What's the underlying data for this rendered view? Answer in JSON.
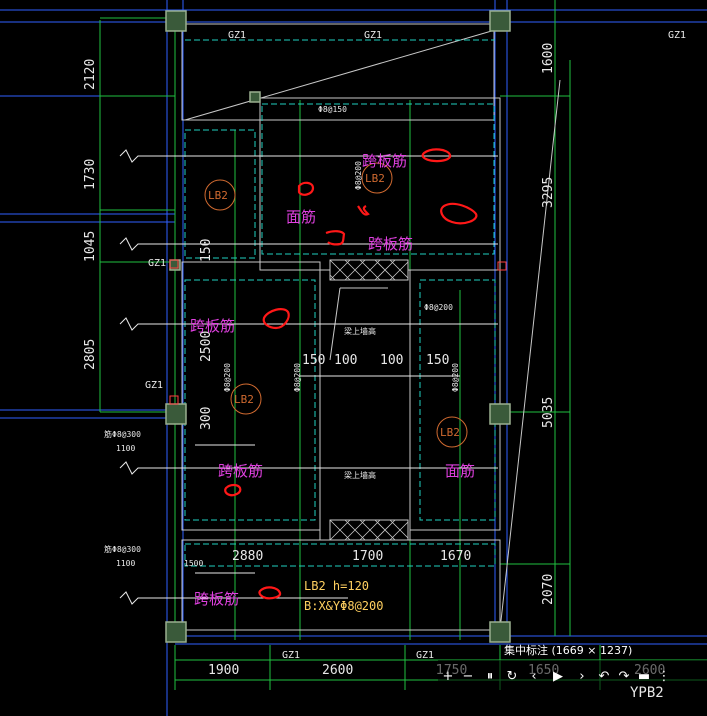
{
  "drawing": {
    "dims_left": [
      "2120",
      "1730",
      "1045",
      "2805"
    ],
    "dims_right": [
      "1600",
      "3295",
      "5035",
      "2070"
    ],
    "dims_middle": [
      "150",
      "100",
      "100",
      "150"
    ],
    "dims_middle_row": [
      "2880",
      "1700",
      "1670"
    ],
    "dims_bottom": [
      "1900",
      "2600",
      "1750",
      "1650",
      "2600"
    ],
    "dim_150": "150",
    "dim_2500": "2500",
    "dim_300": "300",
    "gz_tags": [
      "GZ1",
      "GZ1",
      "GZ1",
      "GZ1",
      "GZ1",
      "GZ1",
      "GZ1"
    ],
    "slab_tags": [
      "LB2",
      "LB2",
      "LB2",
      "LB2"
    ],
    "ypb_label": "YPB2",
    "beam_notes": [
      "梁上墙高",
      "梁上墙高"
    ],
    "rebar_label_1": "Φ8@150",
    "rebar_label_2": "Φ8@200",
    "small_notes": [
      "Φ8@200",
      "Φ8@200",
      "Φ8@200",
      "Φ8@200"
    ],
    "side_notes": [
      "筋Φ8@300",
      "筋Φ8@300"
    ],
    "tiny_dims": [
      "1100",
      "1100",
      "1500"
    ],
    "slab_spec_line1": "LB2 h=120",
    "slab_spec_line2": "B:X&YΦ8@200",
    "annotations": [
      "跨板筋",
      "面筋",
      "跨板筋",
      "跨板筋",
      "跨板筋",
      "面筋",
      "跨板筋"
    ]
  },
  "viewer": {
    "title": "集中标注 (1669 × 1237)",
    "buttons": [
      "+",
      "−",
      "⏸",
      "↻",
      "‹",
      "▶",
      "›",
      "↶",
      "↷",
      "▬",
      "⋮"
    ]
  },
  "colors": {
    "background": "#000000",
    "column": "#7a9a70",
    "dimension": "#e8e8e8",
    "wall": "#c8c8c8",
    "dashed": "#20d0c0",
    "tag": "#d06a30",
    "spec": "#ffd060",
    "annotation": "#e040e0",
    "markup": "#ff1818",
    "grid_green": "#20c040",
    "grid_blue": "#3060ff"
  }
}
